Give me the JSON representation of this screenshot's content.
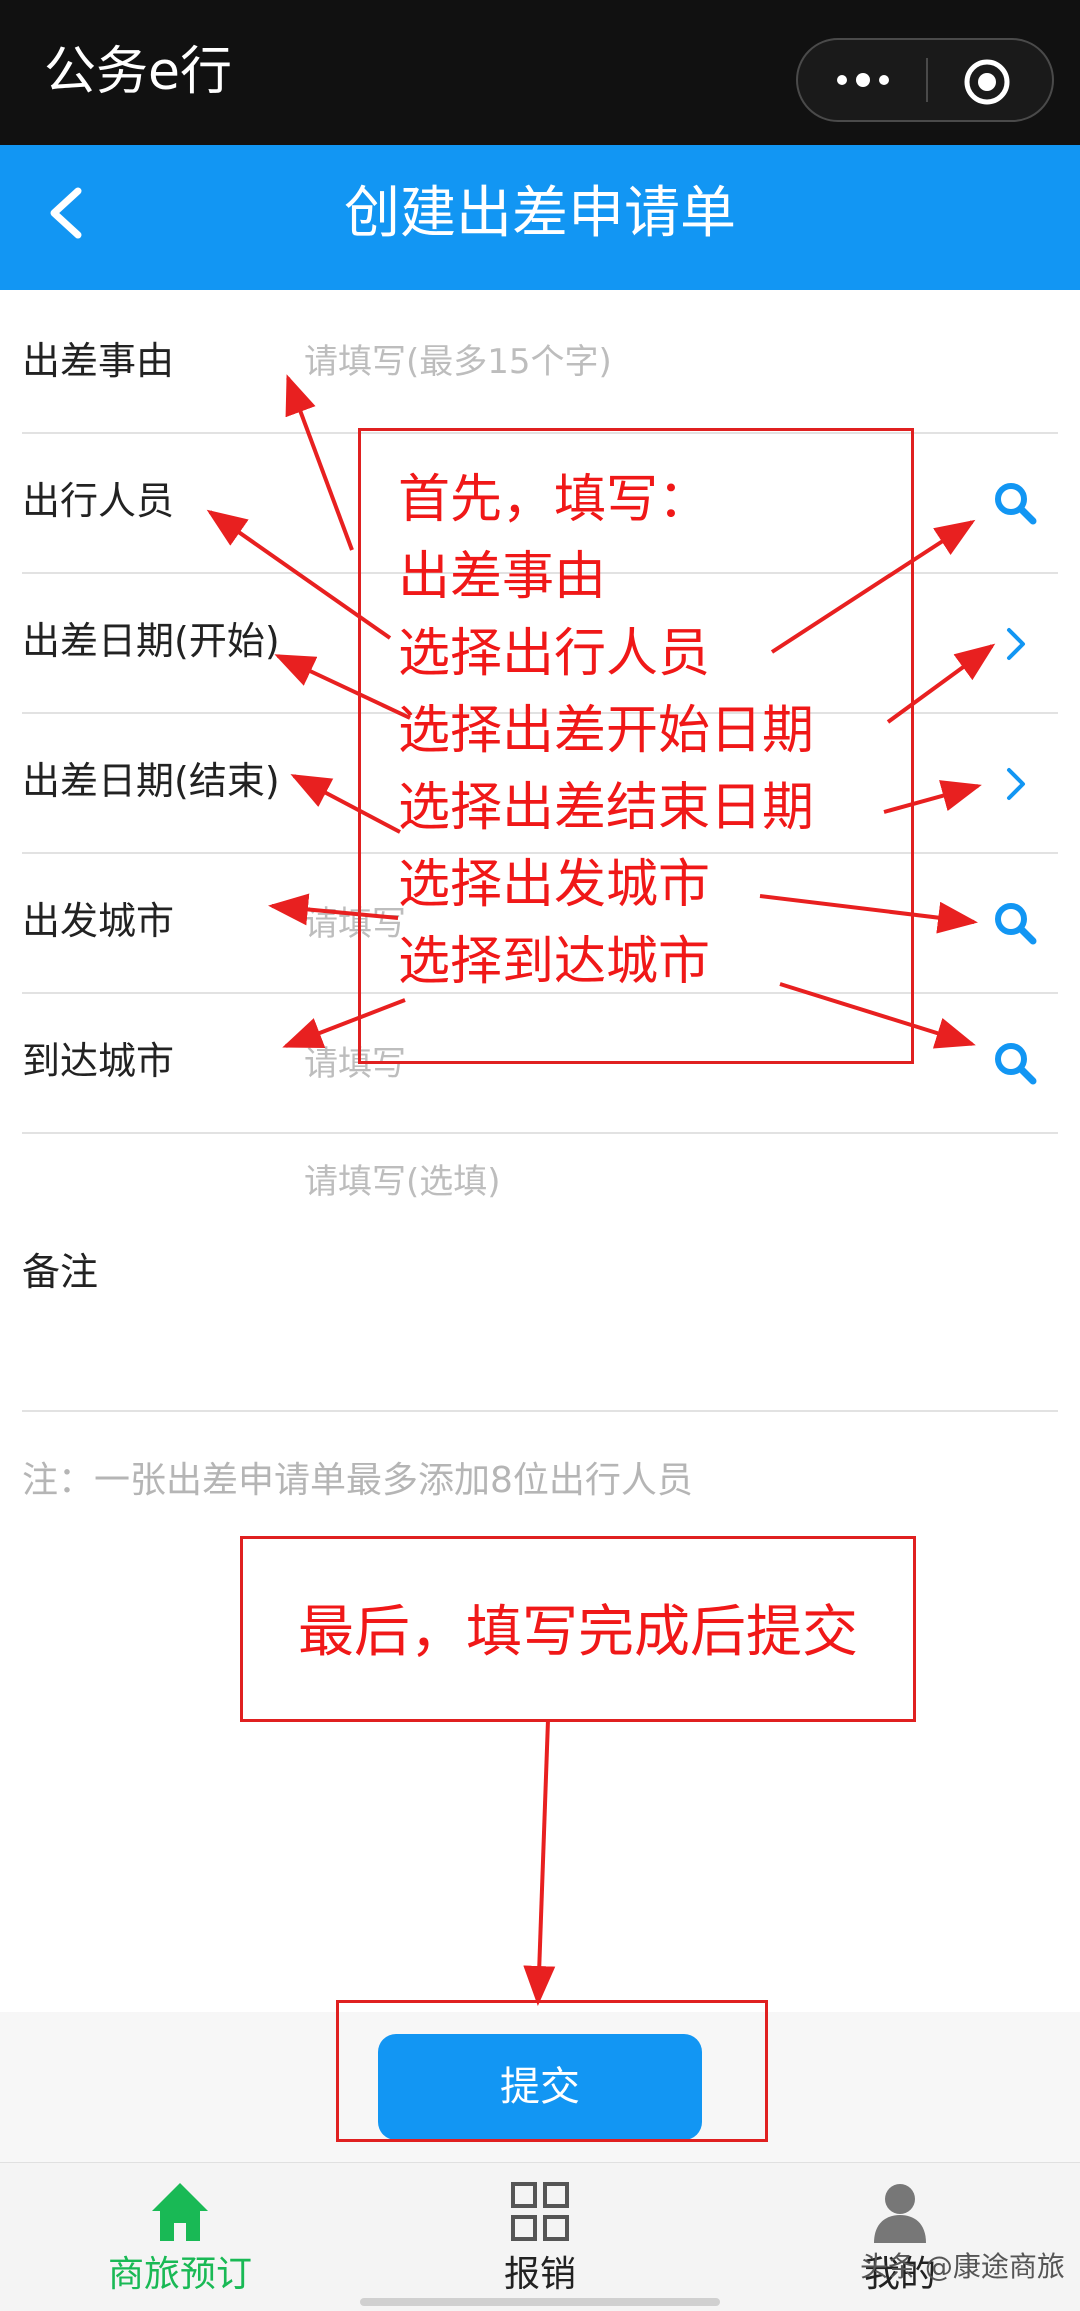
{
  "app": {
    "title": "公务e行"
  },
  "header": {
    "title": "创建出差申请单"
  },
  "form": {
    "rows": [
      {
        "label": "出差事由",
        "placeholder": "请填写(最多15个字)",
        "icon": "none"
      },
      {
        "label": "出行人员",
        "placeholder": "",
        "icon": "search-icon"
      },
      {
        "label": "出差日期(开始)",
        "placeholder": "",
        "icon": "chevron-right-icon"
      },
      {
        "label": "出差日期(结束)",
        "placeholder": "",
        "icon": "chevron-right-icon"
      },
      {
        "label": "出发城市",
        "placeholder": "请填写",
        "icon": "search-icon"
      },
      {
        "label": "到达城市",
        "placeholder": "请填写",
        "icon": "search-icon"
      }
    ],
    "remark": {
      "label": "备注",
      "placeholder": "请填写(选填)"
    },
    "note": "注：一张出差申请单最多添加8位出行人员"
  },
  "annotations": {
    "lines": [
      "首先，填写：",
      "出差事由",
      "选择出行人员",
      "选择出差开始日期",
      "选择出差结束日期",
      "选择出发城市",
      "选择到达城市"
    ],
    "final": "最后，填写完成后提交"
  },
  "submit": {
    "label": "提交"
  },
  "tabbar": {
    "items": [
      {
        "label": "商旅预订",
        "icon": "home-icon",
        "active": true
      },
      {
        "label": "报销",
        "icon": "grid-icon",
        "active": false
      },
      {
        "label": "我的",
        "icon": "user-icon",
        "active": false
      }
    ]
  },
  "watermark": "头条 @康途商旅",
  "colors": {
    "accent_blue": "#1296f3",
    "active_green": "#19b955",
    "annotation_red": "#f01818",
    "top_bar": "#111111"
  }
}
